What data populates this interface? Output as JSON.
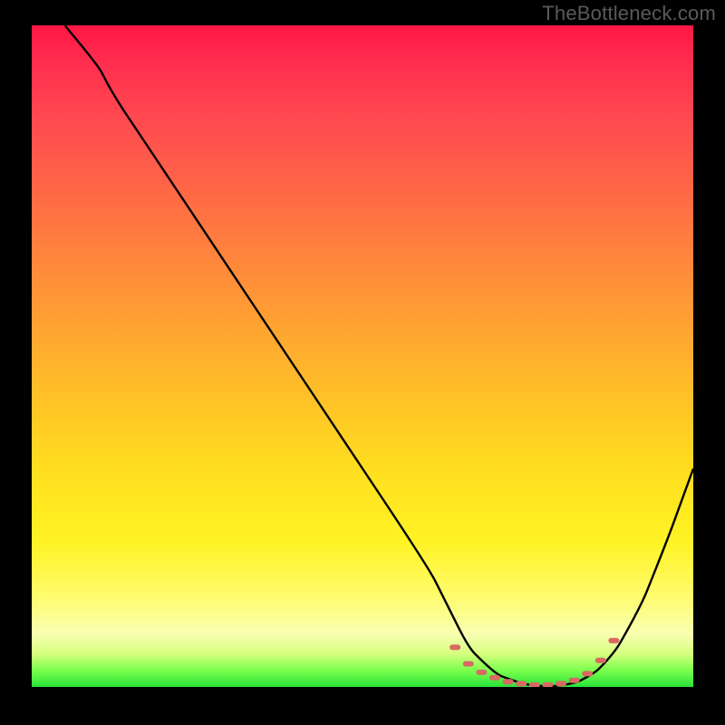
{
  "watermark": "TheBottleneck.com",
  "chart_data": {
    "type": "line",
    "title": "",
    "xlabel": "",
    "ylabel": "",
    "xlim": [
      0,
      100
    ],
    "ylim": [
      0,
      100
    ],
    "grid": false,
    "legend": false,
    "series": [
      {
        "name": "bottleneck-curve",
        "color": "#000000",
        "x": [
          5,
          10,
          12,
          20,
          30,
          40,
          50,
          60,
          64,
          66,
          70,
          74,
          78,
          82,
          85,
          88,
          92,
          96,
          100
        ],
        "y": [
          100,
          94,
          90,
          78,
          63,
          48,
          33,
          18,
          10,
          6,
          2,
          0.5,
          0,
          0.5,
          2,
          5,
          12,
          22,
          33
        ]
      }
    ],
    "plateau_markers": {
      "name": "dotted-plateau",
      "color": "#d86a62",
      "x": [
        64,
        66,
        68,
        70,
        72,
        74,
        76,
        78,
        80,
        82,
        84,
        86,
        88
      ],
      "y": [
        6,
        3.5,
        2.2,
        1.4,
        0.8,
        0.5,
        0.3,
        0.3,
        0.5,
        1.0,
        2.0,
        4.0,
        7.0
      ]
    },
    "gradient_stops": [
      {
        "pos": 0.0,
        "color": "#ff1744"
      },
      {
        "pos": 0.5,
        "color": "#ffaa2f"
      },
      {
        "pos": 0.8,
        "color": "#fff324"
      },
      {
        "pos": 0.96,
        "color": "#d6ff7e"
      },
      {
        "pos": 1.0,
        "color": "#29e23a"
      }
    ]
  }
}
